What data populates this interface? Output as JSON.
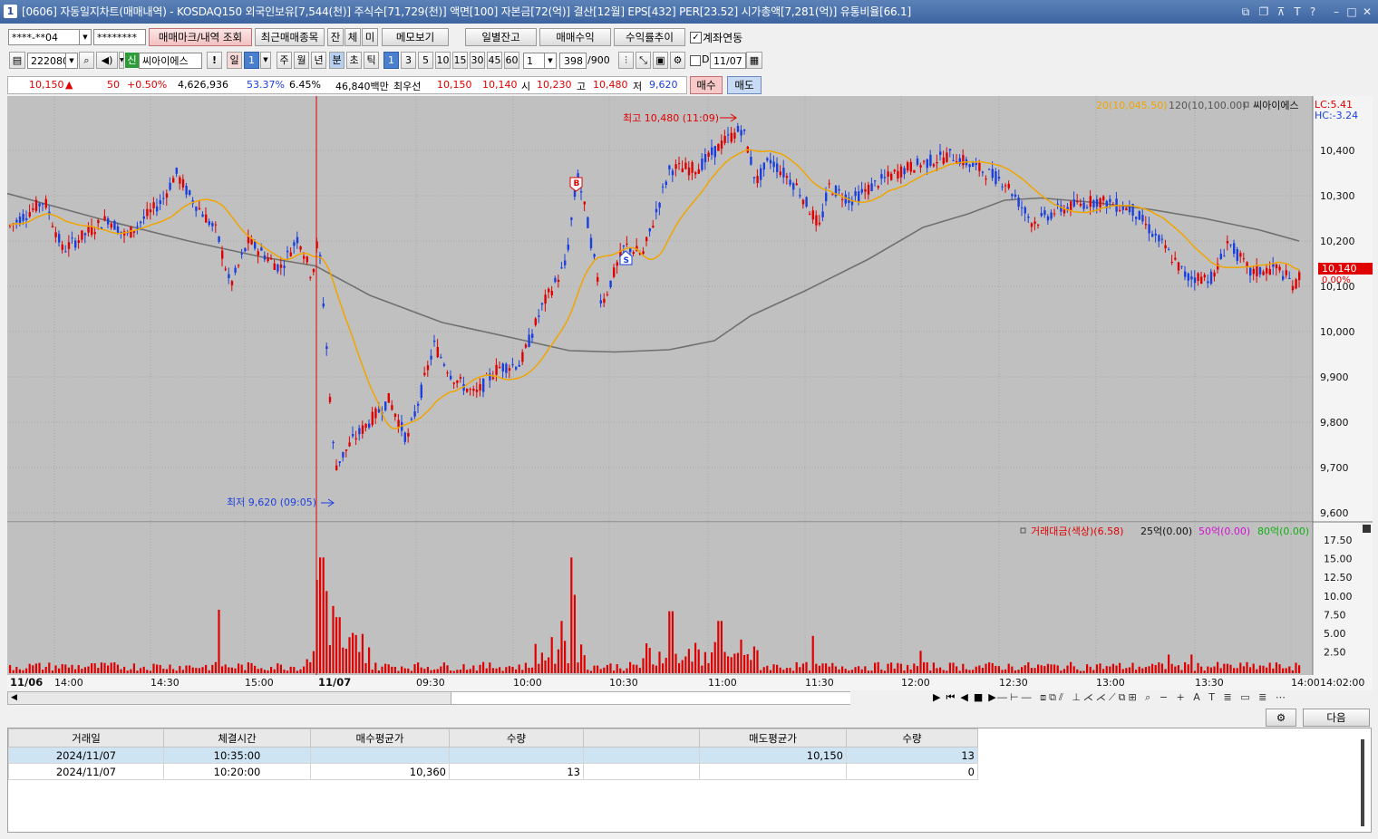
{
  "window": {
    "app_num": "1",
    "title": "[0606] 자동일지차트(매매내역) - KOSDAQ150 외국인보유[7,544(천)] 주식수[71,729(천)] 액면[100] 자본금[72(억)] 결산[12월] EPS[432] PER[23.52] 시가총액[7,281(억)] 유통비율[66.1]"
  },
  "toolbar1": {
    "account": "****-**04",
    "password": "********",
    "btn_trade_mark": "매매마크/내역 조회",
    "btn_recent": "최근매매종목",
    "toggle_jan": "잔",
    "toggle_che": "체",
    "toggle_mi": "미",
    "btn_memo": "메모보기",
    "btn_daily_balance": "일별잔고",
    "btn_trade_profit": "매매수익",
    "btn_return_trend": "수익률추이",
    "account_link_label": "계좌연동",
    "account_link_checked": true
  },
  "toolbar2": {
    "code": "222080",
    "credit_badge": "신",
    "stock_name": "씨아이에스",
    "alert": "!",
    "period_day": "일",
    "period_val": "1",
    "period_week": "주",
    "period_month": "월",
    "period_year": "년",
    "period_min": "분",
    "period_sec": "초",
    "period_tick": "틱",
    "minutes": [
      "1",
      "3",
      "5",
      "10",
      "15",
      "30",
      "45",
      "60"
    ],
    "selected_minute": "1",
    "custom_min": "1",
    "count": "398",
    "count_total": "/900",
    "date_check": "D",
    "date": "11/07"
  },
  "quote": {
    "price": "10,150",
    "change": "50",
    "change_pct": "+0.50%",
    "volume": "4,626,936",
    "vol_ratio": "53.37%",
    "turnover": "6.45%",
    "amount": "46,840백만",
    "best_label": "최우선",
    "ask": "10,150",
    "bid": "10,140",
    "open_label": "시",
    "open": "10,230",
    "high_label": "고",
    "high": "10,480",
    "low_label": "저",
    "low": "9,620",
    "buy_btn": "매수",
    "sell_btn": "매도"
  },
  "chart": {
    "legend_ma20": "20(10,045.50)",
    "legend_ma120": "120(10,100.00)",
    "legend_name": "씨아이에스",
    "lc": "LC:5.41",
    "hc": "HC:-3.24",
    "high_note": "최고 10,480 (11:09)",
    "low_note": "최저 9,620 (09:05)",
    "buy_marker": "B",
    "sell_marker": "S",
    "price_ticks": [
      "10,400",
      "10,300",
      "10,200",
      "10,100",
      "10,000",
      "9,900",
      "9,800",
      "9,700",
      "9,600"
    ],
    "current_price_tag": "10,140",
    "current_pct_tag": "0.00%",
    "vol_legend_main": "거래대금(색상)(6.58)",
    "vol_legend_25": "25억(0.00)",
    "vol_legend_50": "50억(0.00)",
    "vol_legend_80": "80억(0.00)",
    "vol_ticks": [
      "17.50",
      "15.00",
      "12.50",
      "10.00",
      "7.50",
      "5.00",
      "2.50"
    ],
    "date_prev": "11/06",
    "date_cur": "11/07",
    "time_ticks": [
      "14:00",
      "14:30",
      "15:00",
      "09:30",
      "10:00",
      "10:30",
      "11:00",
      "11:30",
      "12:00",
      "12:30",
      "13:00",
      "13:30",
      "14:00"
    ],
    "cursor_time": "14:02:00",
    "colors": {
      "up": "#e00000",
      "down": "#1a3fe0",
      "ma20": "#f0a500",
      "ma120": "#707070",
      "bg": "#c0c0c0"
    }
  },
  "bottom": {
    "next_btn": "다음",
    "columns": [
      "거래일",
      "체결시간",
      "매수평균가",
      "수량",
      "",
      "매도평균가",
      "수량"
    ],
    "rows": [
      [
        "2024/11/07",
        "10:35:00",
        "",
        "",
        "",
        "10,150",
        "13"
      ],
      [
        "2024/11/07",
        "10:20:00",
        "10,360",
        "13",
        "",
        "",
        "0"
      ]
    ]
  }
}
